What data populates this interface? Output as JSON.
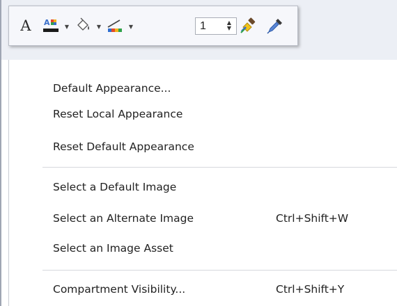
{
  "toolbar": {
    "font_icon_glyph": "A",
    "font_icon": "font-icon",
    "font_color_icon": "font-color-icon",
    "fill_color_icon": "fill-color-icon",
    "line_color_icon": "line-color-icon",
    "dropdown_glyph": "▼",
    "line_width_value": "1",
    "spinner_up_glyph": "▲",
    "spinner_down_glyph": "▼",
    "apply_style_icon": "paint-brush-icon",
    "pick_style_icon": "eyedropper-icon",
    "colors": {
      "font_color_bar": "#1a1a1a",
      "fill_color_bar": "#2e6fd1",
      "line_color_bar": "#e24a2b"
    }
  },
  "menu": {
    "groups": [
      {
        "items": [
          {
            "label": "Default Appearance...",
            "shortcut": ""
          },
          {
            "label": "Reset Local Appearance",
            "shortcut": ""
          },
          {
            "label": "Reset Default Appearance",
            "shortcut": ""
          }
        ]
      },
      {
        "items": [
          {
            "label": "Select a Default Image",
            "shortcut": ""
          },
          {
            "label": "Select an Alternate Image",
            "shortcut": "Ctrl+Shift+W"
          },
          {
            "label": "Select an Image Asset",
            "shortcut": ""
          }
        ]
      },
      {
        "items": [
          {
            "label": "Compartment Visibility...",
            "shortcut": "Ctrl+Shift+Y"
          }
        ]
      }
    ]
  }
}
